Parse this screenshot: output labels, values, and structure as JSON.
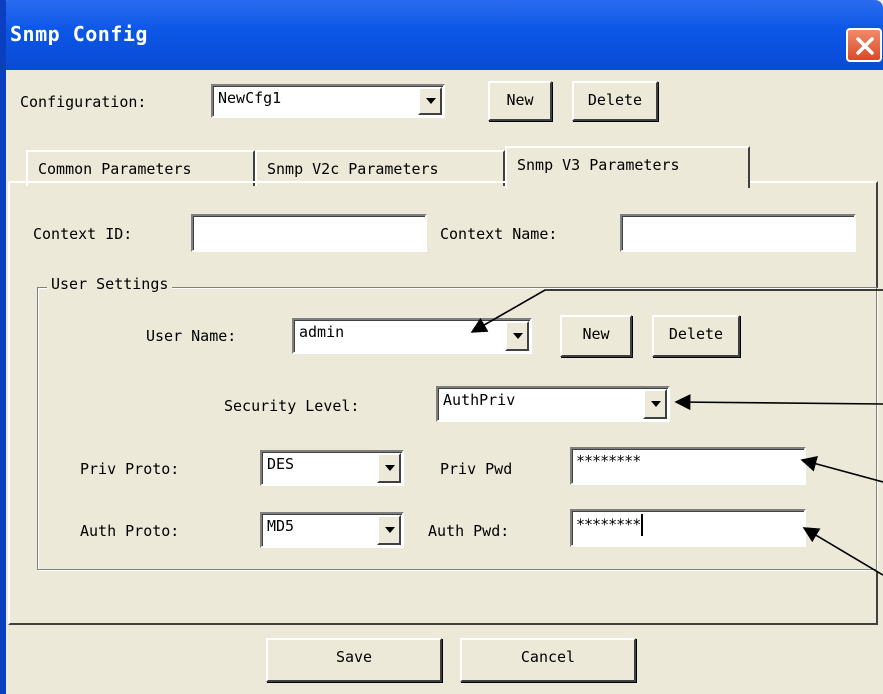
{
  "window": {
    "title": "Snmp Config"
  },
  "configuration": {
    "label": "Configuration:",
    "value": "NewCfg1",
    "new_label": "New",
    "delete_label": "Delete"
  },
  "tabs": [
    {
      "label": "Common Parameters",
      "active": false
    },
    {
      "label": "Snmp V2c Parameters",
      "active": false
    },
    {
      "label": "Snmp V3 Parameters",
      "active": true
    }
  ],
  "context": {
    "id_label": "Context ID:",
    "id_value": "",
    "name_label": "Context Name:",
    "name_value": ""
  },
  "user_settings": {
    "title": "User Settings",
    "user_name_label": "User Name:",
    "user_name_value": "admin",
    "new_label": "New",
    "delete_label": "Delete",
    "security_level_label": "Security Level:",
    "security_level_value": "AuthPriv",
    "priv_proto_label": "Priv Proto:",
    "priv_proto_value": "DES",
    "priv_pwd_label": "Priv Pwd",
    "priv_pwd_value": "********",
    "auth_proto_label": "Auth Proto:",
    "auth_proto_value": "MD5",
    "auth_pwd_label": "Auth Pwd:",
    "auth_pwd_value": "********"
  },
  "footer": {
    "save_label": "Save",
    "cancel_label": "Cancel"
  },
  "colors": {
    "titlebar": "#0b56e6",
    "dialog_bg": "#ece9d8",
    "close_button": "#d84a2a"
  }
}
